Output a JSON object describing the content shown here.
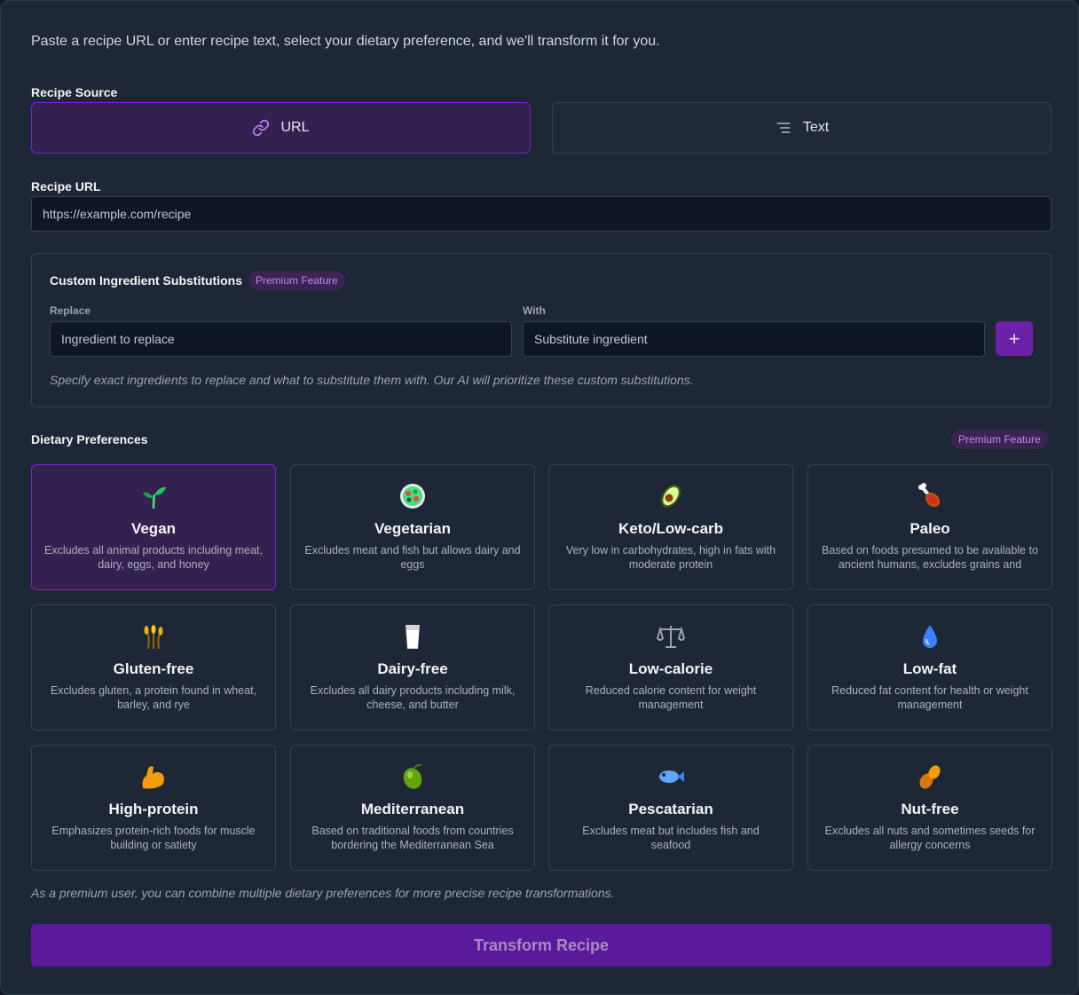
{
  "intro": "Paste a recipe URL or enter recipe text, select your dietary preference, and we'll transform it for you.",
  "source": {
    "label": "Recipe Source",
    "url_label": "URL",
    "text_label": "Text",
    "selected": "URL"
  },
  "recipe_url": {
    "label": "Recipe URL",
    "placeholder": "https://example.com/recipe",
    "value": ""
  },
  "substitutions": {
    "title": "Custom Ingredient Substitutions",
    "badge": "Premium Feature",
    "replace_label": "Replace",
    "replace_placeholder": "Ingredient to replace",
    "with_label": "With",
    "with_placeholder": "Substitute ingredient",
    "add_symbol": "+",
    "hint": "Specify exact ingredients to replace and what to substitute them with. Our AI will prioritize these custom substitutions."
  },
  "dietary": {
    "label": "Dietary Preferences",
    "badge": "Premium Feature",
    "options": [
      {
        "icon": "seedling-icon",
        "emoji": "🌱",
        "name": "Vegan",
        "desc": "Excludes all animal products including meat, dairy, eggs, and honey",
        "selected": true
      },
      {
        "icon": "salad-icon",
        "emoji": "🥗",
        "name": "Vegetarian",
        "desc": "Excludes meat and fish but allows dairy and eggs",
        "selected": false
      },
      {
        "icon": "avocado-icon",
        "emoji": "🥑",
        "name": "Keto/Low-carb",
        "desc": "Very low in carbohydrates, high in fats with moderate protein",
        "selected": false
      },
      {
        "icon": "meat-on-bone-icon",
        "emoji": "🍖",
        "name": "Paleo",
        "desc": "Based on foods presumed to be available to ancient humans, excludes grains and legumes",
        "selected": false
      },
      {
        "icon": "rice-sheaf-icon",
        "emoji": "🌾",
        "name": "Gluten-free",
        "desc": "Excludes gluten, a protein found in wheat, barley, and rye",
        "selected": false
      },
      {
        "icon": "milk-glass-icon",
        "emoji": "🥛",
        "name": "Dairy-free",
        "desc": "Excludes all dairy products including milk, cheese, and butter",
        "selected": false
      },
      {
        "icon": "balance-scale-icon",
        "emoji": "⚖",
        "name": "Low-calorie",
        "desc": "Reduced calorie content for weight management",
        "selected": false
      },
      {
        "icon": "droplet-icon",
        "emoji": "💧",
        "name": "Low-fat",
        "desc": "Reduced fat content for health or weight management",
        "selected": false
      },
      {
        "icon": "flexed-biceps-icon",
        "emoji": "💪",
        "name": "High-protein",
        "desc": "Emphasizes protein-rich foods for muscle building or satiety",
        "selected": false
      },
      {
        "icon": "olive-icon",
        "emoji": "🫒",
        "name": "Mediterranean",
        "desc": "Based on traditional foods from countries bordering the Mediterranean Sea",
        "selected": false
      },
      {
        "icon": "fish-icon",
        "emoji": "🐟",
        "name": "Pescatarian",
        "desc": "Excludes meat but includes fish and seafood",
        "selected": false
      },
      {
        "icon": "peanuts-icon",
        "emoji": "🥜",
        "name": "Nut-free",
        "desc": "Excludes all nuts and sometimes seeds for allergy concerns",
        "selected": false
      }
    ],
    "note": "As a premium user, you can combine multiple dietary preferences for more precise recipe transformations."
  },
  "transform_button": "Transform Recipe",
  "colors": {
    "accent": "#7e22ce",
    "accent_bg": "#33224f",
    "badge_text": "#c084fc",
    "button_bg": "#5b1a9c"
  }
}
